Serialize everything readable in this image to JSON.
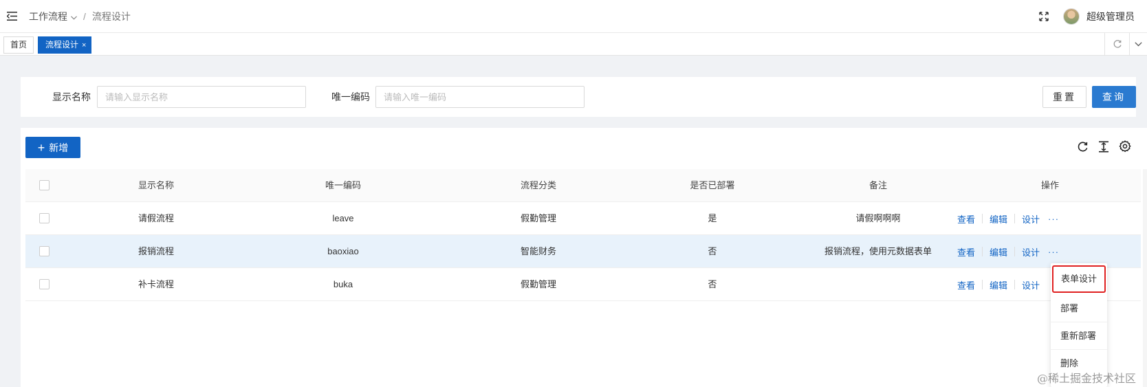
{
  "header": {
    "breadcrumb": [
      "工作流程",
      "流程设计"
    ],
    "separator": "/",
    "username": "超级管理员"
  },
  "tabs": {
    "home": "首页",
    "active": "流程设计",
    "close": "×"
  },
  "search": {
    "name_label": "显示名称",
    "name_placeholder": "请输入显示名称",
    "code_label": "唯一编码",
    "code_placeholder": "请输入唯一编码",
    "reset_label": "重置",
    "query_label": "查询"
  },
  "toolbar": {
    "add_label": "新增"
  },
  "table": {
    "columns": [
      "显示名称",
      "唯一编码",
      "流程分类",
      "是否已部署",
      "备注",
      "操作"
    ],
    "rows": [
      {
        "name": "请假流程",
        "code": "leave",
        "category": "假勤管理",
        "deployed": "是",
        "note": "请假啊啊啊"
      },
      {
        "name": "报销流程",
        "code": "baoxiao",
        "category": "智能财务",
        "deployed": "否",
        "note": "报销流程，使用元数据表单"
      },
      {
        "name": "补卡流程",
        "code": "buka",
        "category": "假勤管理",
        "deployed": "否",
        "note": ""
      }
    ],
    "actions": {
      "view": "查看",
      "edit": "编辑",
      "design": "设计",
      "more": "···"
    }
  },
  "dropdown": {
    "items": [
      "表单设计",
      "部署",
      "重新部署",
      "删除"
    ]
  },
  "watermark": "@稀土掘金技术社区",
  "colors": {
    "primary": "#1264c4",
    "query": "#2a7ad0",
    "highlight_row": "#e8f2fb",
    "selection_outline": "#e02020",
    "background": "#f0f2f5"
  }
}
